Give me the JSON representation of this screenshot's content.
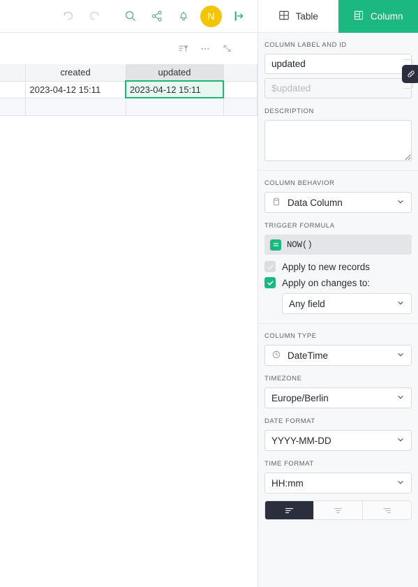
{
  "toolbar": {
    "undo_icon": "undo-icon",
    "redo_icon": "redo-icon",
    "search_icon": "search-icon",
    "share_icon": "share-icon",
    "notifications_icon": "bell-icon",
    "avatar_initial": "N",
    "logout_icon": "logout-icon"
  },
  "grid_toolbar": {
    "filter_icon": "filter-icon",
    "more_icon": "more-options-icon",
    "collapse_icon": "collapse-icon"
  },
  "grid": {
    "columns": [
      "",
      "created",
      "updated",
      ""
    ],
    "active_column": "updated",
    "rows": [
      {
        "cells": [
          "",
          "2023-04-12 15:11",
          "2023-04-12 15:11",
          ""
        ],
        "selected_cell": "updated"
      },
      {
        "cells": [
          "",
          "",
          "",
          ""
        ],
        "selected_cell": null
      }
    ]
  },
  "panel": {
    "tabs": [
      {
        "label": "Table",
        "icon": "table-icon",
        "active": false
      },
      {
        "label": "Column",
        "icon": "column-icon",
        "active": true
      }
    ],
    "column_label_and_id": {
      "heading": "COLUMN LABEL AND ID",
      "label_value": "updated",
      "id_placeholder": "$updated",
      "link_icon": "link-icon"
    },
    "description": {
      "heading": "DESCRIPTION",
      "value": "",
      "placeholder": ""
    },
    "column_behavior": {
      "heading": "COLUMN BEHAVIOR",
      "value": "Data Column",
      "icon": "database-icon"
    },
    "trigger_formula": {
      "heading": "TRIGGER FORMULA",
      "formula": "NOW()",
      "formula_icon": "formula-icon",
      "apply_new_records": {
        "label": "Apply to new records",
        "checked": true,
        "disabled": true
      },
      "apply_on_changes": {
        "label": "Apply on changes to:",
        "checked": true,
        "disabled": false
      },
      "changes_scope": "Any field"
    },
    "column_type": {
      "heading": "COLUMN TYPE",
      "value": "DateTime",
      "icon": "clock-icon"
    },
    "timezone": {
      "heading": "TIMEZONE",
      "value": "Europe/Berlin"
    },
    "date_format": {
      "heading": "DATE FORMAT",
      "value": "YYYY-MM-DD"
    },
    "time_format": {
      "heading": "TIME FORMAT",
      "value": "HH:mm"
    },
    "alignment": {
      "options": [
        "align-left",
        "align-center",
        "align-right"
      ],
      "selected": "align-left"
    }
  },
  "colors": {
    "accent_green": "#1bb981",
    "avatar_yellow": "#f2c500",
    "selected_cell_bg": "#e6f8ef",
    "dark": "#2b2e3d"
  }
}
